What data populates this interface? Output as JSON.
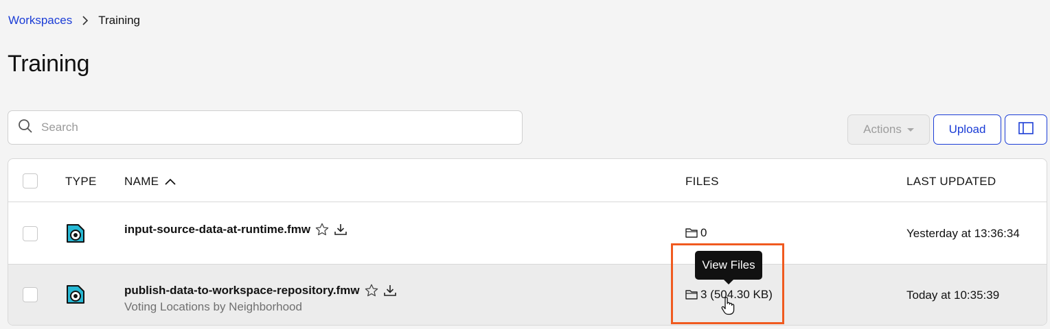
{
  "breadcrumb": {
    "root": "Workspaces",
    "current": "Training"
  },
  "page": {
    "title": "Training"
  },
  "search": {
    "placeholder": "Search"
  },
  "toolbar": {
    "actions_label": "Actions",
    "upload_label": "Upload"
  },
  "table": {
    "columns": {
      "type": "TYPE",
      "name": "NAME",
      "files": "FILES",
      "last_updated": "LAST UPDATED"
    },
    "sort": {
      "column": "NAME",
      "direction": "ascending"
    },
    "rows": [
      {
        "name": "input-source-data-at-runtime.fmw",
        "description": "",
        "files": "0",
        "last_updated": "Yesterday at 13:36:34"
      },
      {
        "name": "publish-data-to-workspace-repository.fmw",
        "description": "Voting Locations by Neighborhood",
        "files": "3 (504.30 KB)",
        "last_updated": "Today at 10:35:39"
      }
    ]
  },
  "tooltip": {
    "text": "View Files"
  },
  "colors": {
    "link": "#1a3cd6",
    "highlight": "#f05a1f",
    "type_icon": "#27b8d4"
  },
  "icons": {
    "type": "workspace-icon",
    "star": "star-icon",
    "download": "download-icon",
    "folder": "folder-icon"
  }
}
